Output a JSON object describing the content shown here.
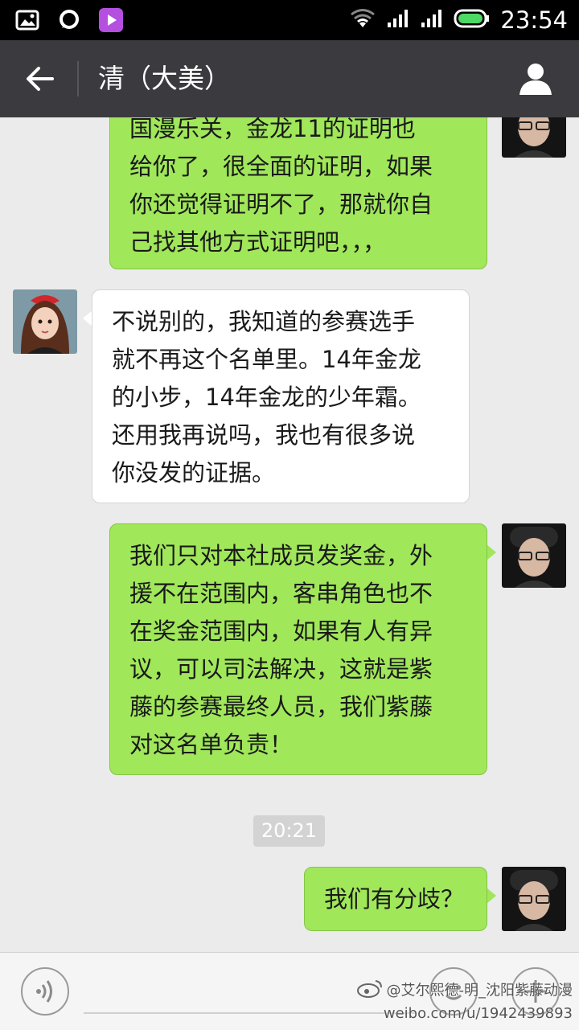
{
  "status_bar": {
    "time": "23:54",
    "icons": [
      "image-icon",
      "message-bubble-icon",
      "video-player-icon",
      "wifi-icon",
      "signal-icon",
      "signal-icon",
      "battery-icon"
    ]
  },
  "header": {
    "title": "清（大美）",
    "back_icon": "back-arrow-icon",
    "profile_icon": "person-icon"
  },
  "messages": [
    {
      "side": "out",
      "lines": [
        "国漫乐关，金龙11的证明也",
        "给你了，很全面的证明，如果",
        "你还觉得证明不了，那就你自",
        "己找其他方式证明吧，，，"
      ]
    },
    {
      "side": "in",
      "lines": [
        "不说别的，我知道的参赛选手",
        "就不再这个名单里。14年金龙",
        "的小步，14年金龙的少年霜。",
        "还用我再说吗，我也有很多说",
        "你没发的证据。"
      ]
    },
    {
      "side": "out",
      "lines": [
        "我们只对本社成员发奖金，外",
        "援不在范围内，客串角色也不",
        "在奖金范围内，如果有人有异",
        "议，可以司法解决，这就是紫",
        "藤的参赛最终人员，我们紫藤",
        "对这名单负责！"
      ]
    },
    {
      "side": "out",
      "lines": [
        "我们有分歧？"
      ]
    }
  ],
  "timestamp": "20:21",
  "input_bar": {
    "voice_icon": "voice-icon",
    "emoji_icon": "smiley-icon",
    "plus_icon": "plus-icon",
    "text_value": ""
  },
  "watermark": {
    "line1": "@艾尔熙德-明_沈阳紫藤动漫",
    "line2": "weibo.com/u/1942439893"
  },
  "colors": {
    "outgoing_bubble": "#a0e75a",
    "incoming_bubble": "#ffffff",
    "header": "#3a3a3f",
    "chat_bg": "#ebebeb"
  }
}
